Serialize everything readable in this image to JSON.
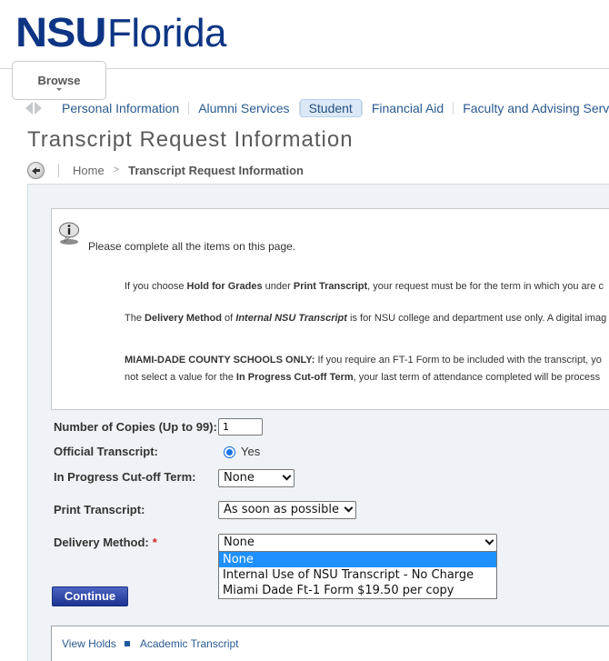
{
  "brand": {
    "nsu": "NSU",
    "florida": "Florida",
    "color": "#0d3584"
  },
  "browse": {
    "label": "Browse"
  },
  "nav": {
    "items": [
      {
        "label": "Personal Information",
        "active": false
      },
      {
        "label": "Alumni Services",
        "active": false
      },
      {
        "label": "Student",
        "active": true
      },
      {
        "label": "Financial Aid",
        "active": false
      },
      {
        "label": "Faculty and Advising Servic",
        "active": false
      }
    ]
  },
  "page": {
    "title": "Transcript Request Information"
  },
  "breadcrumb": {
    "home": "Home",
    "separator": ">",
    "current": "Transcript Request Information"
  },
  "info": {
    "intro": "Please complete all the items on this page.",
    "p1": {
      "a": "If you choose ",
      "b1": "Hold for Grades",
      "c": " under ",
      "b2": "Print Transcript",
      "d": ", your request must be for the term in which you are c"
    },
    "p2": {
      "a": "The ",
      "b1": "Delivery Method",
      "c": " of ",
      "i1": "Internal NSU Transcript",
      "d": " is for NSU college and department use only. A digital imag"
    },
    "p3": {
      "b1": "MIAMI-DADE COUNTY SCHOOLS ONLY:",
      "a": " If you require an FT-1 Form to be included with the transcript, yo",
      "line2a": "not select a value for the ",
      "b2": "In Progress Cut-off Term",
      "line2b": ", your last term of attendance completed will be process"
    }
  },
  "form": {
    "copies": {
      "label": "Number of Copies (Up to 99):",
      "value": "1"
    },
    "official": {
      "label": "Official Transcript:",
      "option": "Yes",
      "checked": true
    },
    "term": {
      "label": "In Progress Cut-off Term:",
      "value": "None"
    },
    "print": {
      "label": "Print Transcript:",
      "value": "As soon as possible"
    },
    "delivery": {
      "label": "Delivery Method:",
      "required_mark": "*",
      "value": "None",
      "options": [
        {
          "label": "None",
          "selected": true
        },
        {
          "label": "Internal Use of NSU Transcript - No Charge",
          "selected": false
        },
        {
          "label": "Miami Dade Ft-1 Form $19.50 per copy",
          "selected": false
        }
      ]
    },
    "continue_label": "Continue"
  },
  "footer": {
    "links": [
      "View Holds",
      "Academic Transcript"
    ]
  }
}
